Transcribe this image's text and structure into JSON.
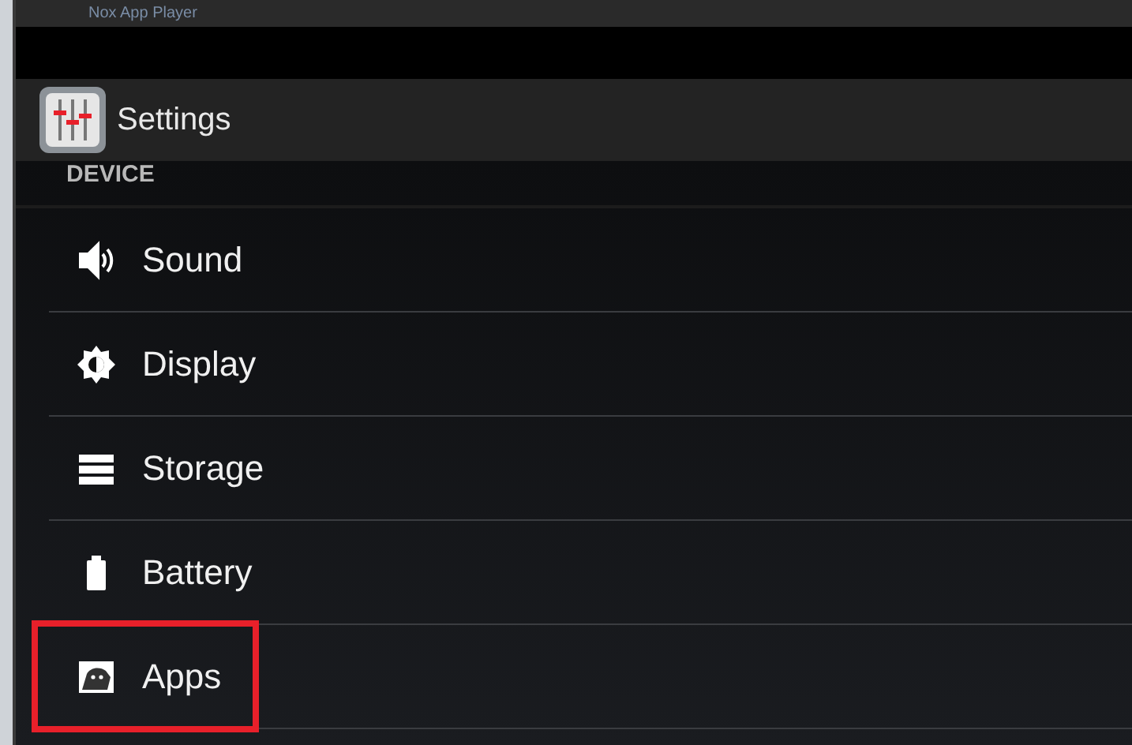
{
  "window": {
    "title": "Nox App Player"
  },
  "action_bar": {
    "title": "Settings"
  },
  "section": {
    "header": "DEVICE"
  },
  "items": [
    {
      "label": "Sound",
      "kind": "sound",
      "highlighted": false
    },
    {
      "label": "Display",
      "kind": "display",
      "highlighted": false
    },
    {
      "label": "Storage",
      "kind": "storage",
      "highlighted": false
    },
    {
      "label": "Battery",
      "kind": "battery",
      "highlighted": false
    },
    {
      "label": "Apps",
      "kind": "apps",
      "highlighted": true
    }
  ]
}
